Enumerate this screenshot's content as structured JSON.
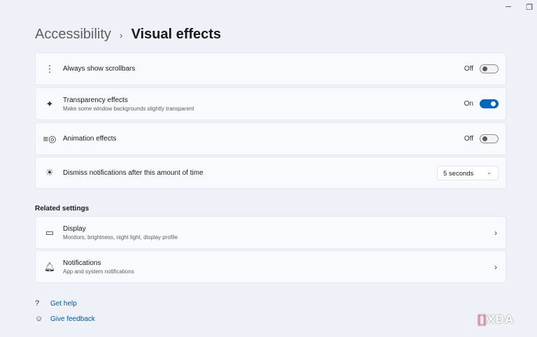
{
  "window": {
    "minimize_icon": "minimize-icon",
    "restore_icon": "restore-icon"
  },
  "breadcrumb": {
    "parent": "Accessibility",
    "separator": "›",
    "current": "Visual effects"
  },
  "settings": [
    {
      "title": "Always show scrollbars",
      "state": "Off",
      "on": false,
      "icon": "scrollbar-icon"
    },
    {
      "title": "Transparency effects",
      "subtitle": "Make some window backgrounds slightly transparent",
      "state": "On",
      "on": true,
      "icon": "transparency-icon"
    },
    {
      "title": "Animation effects",
      "state": "Off",
      "on": false,
      "icon": "animation-icon"
    },
    {
      "title": "Dismiss notifications after this amount of time",
      "value": "5 seconds",
      "icon": "notification-timer-icon"
    }
  ],
  "related": {
    "heading": "Related settings",
    "items": [
      {
        "title": "Display",
        "subtitle": "Monitors, brightness, night light, display profile"
      },
      {
        "title": "Notifications",
        "subtitle": "App and system notifications"
      }
    ]
  },
  "links": {
    "help": "Get help",
    "feedback": "Give feedback"
  },
  "watermark": "XDA",
  "colors": {
    "accent": "#0067c0",
    "background": "#eef2f8",
    "card": "#f9fafd"
  }
}
